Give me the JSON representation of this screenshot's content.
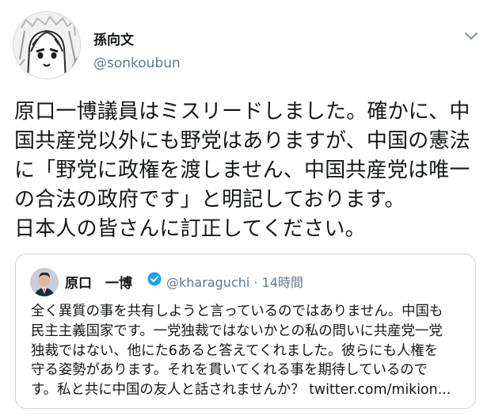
{
  "tweet": {
    "author": {
      "display_name": "孫向文",
      "handle": "@sonkoubun",
      "avatar_icon": "anime-girl-avatar"
    },
    "menu_icon": "chevron-down-icon",
    "text_lines": [
      "原口一博議員はミスリードしました。確かに、中",
      "国共産党以外にも野党はありますが、中国の憲法",
      "に「野党に政権を渡しません、中国共産党は唯一",
      "の合法の政府です」と明記しております。",
      "日本人の皆さんに訂正してください。"
    ],
    "quoted_tweet": {
      "display_name": "原口　一博",
      "verified_icon": "verified-badge-icon",
      "handle_time": "@kharaguchi · 14時間",
      "text_lines": [
        "全く異質の事を共有しようと言っているのではありません。中国も",
        "民主主義国家です。一党独裁ではないかとの私の問いに共産党一党",
        "独裁ではない、他にた6あると答えてくれました。彼らにも人権を",
        "守る姿勢があります。それを貫いてくれる事を期待しているので",
        "す。私と共に中国の友人と話されませんか？ twitter.com/mikion..."
      ]
    }
  },
  "colors": {
    "text": "#14171a",
    "secondary": "#657786",
    "border": "#ccd6dd",
    "verified": "#1da1f2"
  }
}
